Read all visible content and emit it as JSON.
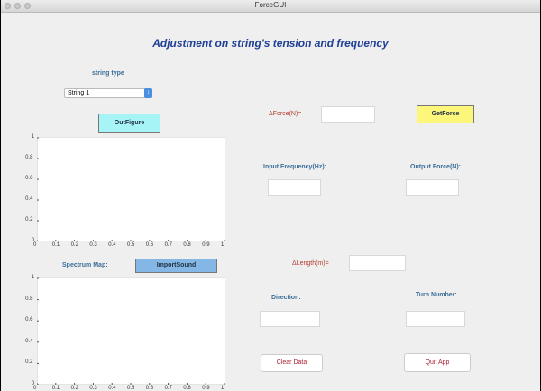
{
  "window": {
    "title": "ForceGUI"
  },
  "heading": "Adjustment on string's tension and frequency",
  "string_type": {
    "label": "string type",
    "selected": "String 1"
  },
  "buttons": {
    "out_figure": "OutFigure",
    "get_force": "GetForce",
    "import_sound": "ImportSound",
    "clear_data": "Clear Data",
    "quit_app": "Quit App"
  },
  "labels": {
    "delta_force": "ΔForce(N)=",
    "input_frequency": "Input Frequency(Hz):",
    "output_force": "Output Force(N):",
    "spectrum_map": "Spectrum Map:",
    "delta_length": "ΔLength(m)=",
    "direction": "Direction:",
    "turn_number": "Turn Number:"
  },
  "axes_ticks": {
    "y": [
      "0",
      "0.2",
      "0.4",
      "0.6",
      "0.8",
      "1"
    ],
    "x": [
      "0",
      "0.1",
      "0.2",
      "0.3",
      "0.4",
      "0.5",
      "0.6",
      "0.7",
      "0.8",
      "0.9",
      "1"
    ]
  },
  "colors": {
    "out_figure_btn": "#a6f4f6",
    "get_force_btn": "#fcf77a",
    "import_sound_btn": "#84b6e6",
    "heading": "#1f3f95",
    "label_blue": "#3a6e99",
    "label_red": "#b33b2e"
  }
}
